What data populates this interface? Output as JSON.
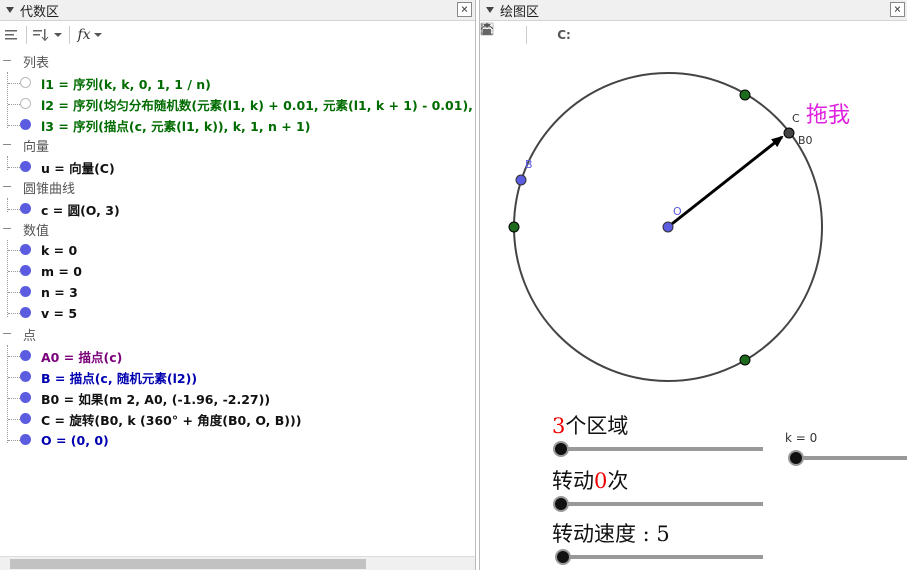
{
  "algebra": {
    "title": "代数区",
    "close": "×",
    "toolbar": {
      "fx": "fx"
    },
    "categories": {
      "list": "列表",
      "vector": "向量",
      "conic": "圆锥曲线",
      "number": "数值",
      "point": "点"
    },
    "items": {
      "l1": "l1 = 序列(k, k, 0, 1, 1 / n)",
      "l2": "l2 = 序列(均匀分布随机数(元素(l1, k) + 0.01, 元素(l1, k + 1) - 0.01),",
      "l3": "l3 = 序列(描点(c, 元素(l1, k)), k, 1, n + 1)",
      "u": "u = 向量(C)",
      "c": "c = 圆(O, 3)",
      "k": "k = 0",
      "m": "m = 0",
      "n": "n = 3",
      "v": "v = 5",
      "A0": "A0 = 描点(c)",
      "B": "B = 描点(c, 随机元素(l2))",
      "B0": "B0 = 如果(m 2, A0, (-1.96, -2.27))",
      "C": "C = 旋转(B0, k (360° + 角度(B0, O, B)))",
      "O": "O = (0, 0)"
    }
  },
  "graphics": {
    "title": "绘图区",
    "close": "×",
    "toolbar": {
      "mode": "C:"
    },
    "point_labels": {
      "O": "O",
      "B": "B",
      "C": "C",
      "B0": "B0"
    },
    "drag_label": "拖我",
    "slider1": {
      "prefix": "",
      "value": "3",
      "suffix": "个区域"
    },
    "slider2": {
      "prefix": "转动",
      "value": "0",
      "suffix": "次"
    },
    "slider3": {
      "text": "转动速度 : 5"
    },
    "slider_k": {
      "text": "k = 0"
    },
    "colors": {
      "point_blue": "#5b5ce0",
      "point_green": "#1e6b1e",
      "drag_magenta": "#e020e0",
      "red": "#e00000"
    }
  }
}
